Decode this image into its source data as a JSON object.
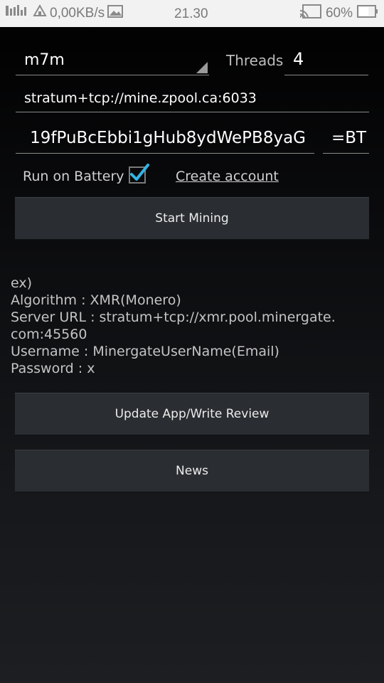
{
  "status_bar": {
    "network_speed": "0,00KB/s",
    "time": "21.30",
    "battery_percent": "60%",
    "icons": [
      "signal-icon",
      "wifi-icon",
      "image-icon",
      "cast-icon",
      "battery-icon"
    ]
  },
  "form": {
    "algorithm": "m7m",
    "threads_label": "Threads",
    "threads_value": "4",
    "server_url": "stratum+tcp://mine.zpool.ca:6033",
    "username": "19fPuBcEbbi1gHub8ydWePB8yaG",
    "password": "=BT",
    "run_on_battery_label": "Run on Battery",
    "run_on_battery_checked": true,
    "create_account_label": "Create account"
  },
  "buttons": {
    "start_mining": "Start Mining",
    "update_app": "Update App/Write Review",
    "news": "News"
  },
  "example": {
    "lines": [
      "ex)",
      "Algorithm : XMR(Monero)",
      "Server URL : stratum+tcp://xmr.pool.minergate.",
      "com:45560",
      "Username : MinergateUserName(Email)",
      "Password : x"
    ]
  },
  "colors": {
    "accent_check": "#33b5e5",
    "button_bg": "#2a2d31",
    "status_bar_bg": "#f2f2f2"
  }
}
